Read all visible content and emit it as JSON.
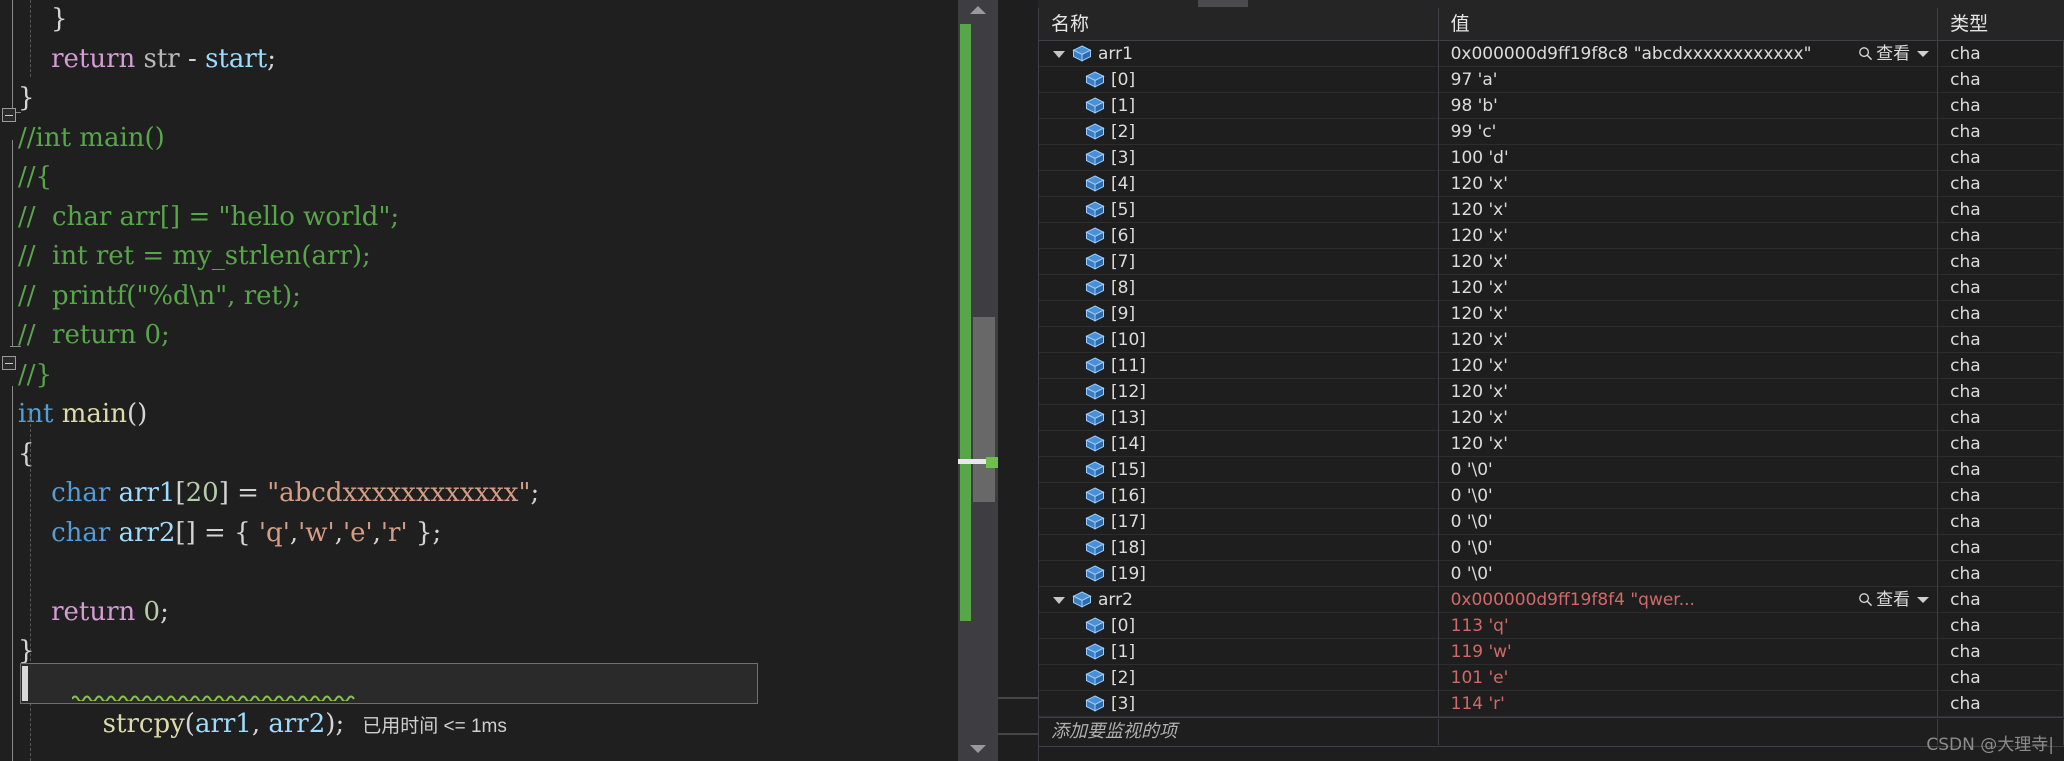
{
  "editor": {
    "lines": [
      {
        "id": "l1",
        "indent": 0,
        "tokens": [
          {
            "t": "    }",
            "c": "punct"
          }
        ]
      },
      {
        "id": "l2",
        "indent": 0,
        "tokens": [
          {
            "t": "    ",
            "c": "plain"
          },
          {
            "t": "return",
            "c": "kw"
          },
          {
            "t": " ",
            "c": "plain"
          },
          {
            "t": "str",
            "c": "plain"
          },
          {
            "t": " - ",
            "c": "punct"
          },
          {
            "t": "start",
            "c": "ident"
          },
          {
            "t": ";",
            "c": "punct"
          }
        ]
      },
      {
        "id": "l3",
        "indent": 0,
        "tokens": [
          {
            "t": "}",
            "c": "punct"
          }
        ]
      },
      {
        "id": "l4",
        "indent": 0,
        "tokens": [
          {
            "t": "//int main()",
            "c": "comment"
          }
        ]
      },
      {
        "id": "l5",
        "indent": 0,
        "tokens": [
          {
            "t": "//{",
            "c": "comment"
          }
        ]
      },
      {
        "id": "l6",
        "indent": 0,
        "tokens": [
          {
            "t": "//  char arr[] = \"hello world\";",
            "c": "comment"
          }
        ]
      },
      {
        "id": "l7",
        "indent": 0,
        "tokens": [
          {
            "t": "//  int ret = my_strlen(arr);",
            "c": "comment"
          }
        ]
      },
      {
        "id": "l8",
        "indent": 0,
        "tokens": [
          {
            "t": "//  printf(\"%d\\n\", ret);",
            "c": "comment"
          }
        ]
      },
      {
        "id": "l9",
        "indent": 0,
        "tokens": [
          {
            "t": "//  return 0;",
            "c": "comment"
          }
        ]
      },
      {
        "id": "l10",
        "indent": 0,
        "tokens": [
          {
            "t": "//}",
            "c": "comment"
          }
        ]
      },
      {
        "id": "l11",
        "indent": 0,
        "tokens": [
          {
            "t": "int",
            "c": "kw-blue"
          },
          {
            "t": " ",
            "c": "plain"
          },
          {
            "t": "main",
            "c": "fn"
          },
          {
            "t": "()",
            "c": "punct"
          }
        ]
      },
      {
        "id": "l12",
        "indent": 0,
        "tokens": [
          {
            "t": "{",
            "c": "punct"
          }
        ]
      },
      {
        "id": "l13",
        "indent": 0,
        "tokens": [
          {
            "t": "    ",
            "c": "plain"
          },
          {
            "t": "char",
            "c": "kw-blue"
          },
          {
            "t": " ",
            "c": "plain"
          },
          {
            "t": "arr1",
            "c": "ident"
          },
          {
            "t": "[",
            "c": "punct"
          },
          {
            "t": "20",
            "c": "num"
          },
          {
            "t": "] = ",
            "c": "punct"
          },
          {
            "t": "\"abcdxxxxxxxxxxxx\"",
            "c": "str"
          },
          {
            "t": ";",
            "c": "punct"
          }
        ]
      },
      {
        "id": "l14",
        "indent": 0,
        "tokens": [
          {
            "t": "    ",
            "c": "plain"
          },
          {
            "t": "char",
            "c": "kw-blue"
          },
          {
            "t": " ",
            "c": "plain"
          },
          {
            "t": "arr2",
            "c": "ident"
          },
          {
            "t": "[] = { ",
            "c": "punct"
          },
          {
            "t": "'q'",
            "c": "str"
          },
          {
            "t": ",",
            "c": "punct"
          },
          {
            "t": "'w'",
            "c": "str"
          },
          {
            "t": ",",
            "c": "punct"
          },
          {
            "t": "'e'",
            "c": "str"
          },
          {
            "t": ",",
            "c": "punct"
          },
          {
            "t": "'r'",
            "c": "str"
          },
          {
            "t": " };",
            "c": "punct"
          }
        ]
      },
      {
        "id": "l16",
        "indent": 0,
        "tokens": [
          {
            "t": "    ",
            "c": "plain"
          },
          {
            "t": "return",
            "c": "kw"
          },
          {
            "t": " ",
            "c": "plain"
          },
          {
            "t": "0",
            "c": "num"
          },
          {
            "t": ";",
            "c": "punct"
          }
        ]
      },
      {
        "id": "l17",
        "indent": 0,
        "tokens": [
          {
            "t": "}",
            "c": "punct"
          }
        ]
      }
    ],
    "current_line": {
      "code_prefix": "    ",
      "fn": "strcpy",
      "open": "(",
      "arg1": "arr1",
      "comma": ", ",
      "arg2": "arr2",
      "close": ")",
      "semi": ";",
      "tooltip": "已用时间 <= 1ms"
    },
    "scrollbar": {
      "up_arrow_icon": "triangle-up-icon",
      "down_arrow_icon": "triangle-down-icon"
    }
  },
  "watch": {
    "columns": [
      {
        "key": "name",
        "label": "名称"
      },
      {
        "key": "value",
        "label": "值"
      },
      {
        "key": "type",
        "label": "类型"
      }
    ],
    "view_label": "查看",
    "add_watch_placeholder": "添加要监视的项",
    "rows": [
      {
        "level": 0,
        "expanded": true,
        "name": "arr1",
        "value": "0x000000d9ff19f8c8 \"abcdxxxxxxxxxxxx\"",
        "type": "cha",
        "color": "white",
        "has_view": true
      },
      {
        "level": 1,
        "expanded": false,
        "name": "[0]",
        "value": "97 'a'",
        "type": "cha",
        "color": "white",
        "has_view": false
      },
      {
        "level": 1,
        "expanded": false,
        "name": "[1]",
        "value": "98 'b'",
        "type": "cha",
        "color": "white",
        "has_view": false
      },
      {
        "level": 1,
        "expanded": false,
        "name": "[2]",
        "value": "99 'c'",
        "type": "cha",
        "color": "white",
        "has_view": false
      },
      {
        "level": 1,
        "expanded": false,
        "name": "[3]",
        "value": "100 'd'",
        "type": "cha",
        "color": "white",
        "has_view": false
      },
      {
        "level": 1,
        "expanded": false,
        "name": "[4]",
        "value": "120 'x'",
        "type": "cha",
        "color": "white",
        "has_view": false
      },
      {
        "level": 1,
        "expanded": false,
        "name": "[5]",
        "value": "120 'x'",
        "type": "cha",
        "color": "white",
        "has_view": false
      },
      {
        "level": 1,
        "expanded": false,
        "name": "[6]",
        "value": "120 'x'",
        "type": "cha",
        "color": "white",
        "has_view": false
      },
      {
        "level": 1,
        "expanded": false,
        "name": "[7]",
        "value": "120 'x'",
        "type": "cha",
        "color": "white",
        "has_view": false
      },
      {
        "level": 1,
        "expanded": false,
        "name": "[8]",
        "value": "120 'x'",
        "type": "cha",
        "color": "white",
        "has_view": false
      },
      {
        "level": 1,
        "expanded": false,
        "name": "[9]",
        "value": "120 'x'",
        "type": "cha",
        "color": "white",
        "has_view": false
      },
      {
        "level": 1,
        "expanded": false,
        "name": "[10]",
        "value": "120 'x'",
        "type": "cha",
        "color": "white",
        "has_view": false
      },
      {
        "level": 1,
        "expanded": false,
        "name": "[11]",
        "value": "120 'x'",
        "type": "cha",
        "color": "white",
        "has_view": false
      },
      {
        "level": 1,
        "expanded": false,
        "name": "[12]",
        "value": "120 'x'",
        "type": "cha",
        "color": "white",
        "has_view": false
      },
      {
        "level": 1,
        "expanded": false,
        "name": "[13]",
        "value": "120 'x'",
        "type": "cha",
        "color": "white",
        "has_view": false
      },
      {
        "level": 1,
        "expanded": false,
        "name": "[14]",
        "value": "120 'x'",
        "type": "cha",
        "color": "white",
        "has_view": false
      },
      {
        "level": 1,
        "expanded": false,
        "name": "[15]",
        "value": "0 '\\0'",
        "type": "cha",
        "color": "white",
        "has_view": false
      },
      {
        "level": 1,
        "expanded": false,
        "name": "[16]",
        "value": "0 '\\0'",
        "type": "cha",
        "color": "white",
        "has_view": false
      },
      {
        "level": 1,
        "expanded": false,
        "name": "[17]",
        "value": "0 '\\0'",
        "type": "cha",
        "color": "white",
        "has_view": false
      },
      {
        "level": 1,
        "expanded": false,
        "name": "[18]",
        "value": "0 '\\0'",
        "type": "cha",
        "color": "white",
        "has_view": false
      },
      {
        "level": 1,
        "expanded": false,
        "name": "[19]",
        "value": "0 '\\0'",
        "type": "cha",
        "color": "white",
        "has_view": false
      },
      {
        "level": 0,
        "expanded": true,
        "name": "arr2",
        "value": "0x000000d9ff19f8f4 \"qwer...",
        "type": "cha",
        "color": "red",
        "has_view": true
      },
      {
        "level": 1,
        "expanded": false,
        "name": "[0]",
        "value": "113 'q'",
        "type": "cha",
        "color": "red",
        "has_view": false
      },
      {
        "level": 1,
        "expanded": false,
        "name": "[1]",
        "value": "119 'w'",
        "type": "cha",
        "color": "red",
        "has_view": false
      },
      {
        "level": 1,
        "expanded": false,
        "name": "[2]",
        "value": "101 'e'",
        "type": "cha",
        "color": "red",
        "has_view": false
      },
      {
        "level": 1,
        "expanded": false,
        "name": "[3]",
        "value": "114 'r'",
        "type": "cha",
        "color": "red",
        "has_view": false
      }
    ]
  },
  "watermark": "CSDN @大理寺|",
  "colors": {
    "background": "#1e1e1e",
    "panel": "#252526",
    "comment_green": "#57a64a",
    "string_orange": "#d69d85",
    "keyword_blue": "#569cd6",
    "identifier_blue": "#9cdcfe",
    "error_red": "#d16969",
    "scrollbar_green": "#57a64a"
  }
}
